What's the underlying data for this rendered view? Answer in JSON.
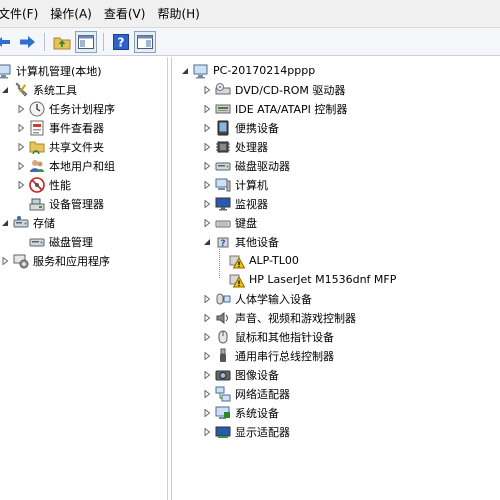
{
  "menubar": {
    "items": [
      "文件(F)",
      "操作(A)",
      "查看(V)",
      "帮助(H)"
    ]
  },
  "left_tree": {
    "root": "计算机管理(本地)",
    "system_tools": "系统工具",
    "task_scheduler": "任务计划程序",
    "event_viewer": "事件查看器",
    "shared_folders": "共享文件夹",
    "local_users": "本地用户和组",
    "performance": "性能",
    "device_manager": "设备管理器",
    "storage": "存储",
    "disk_management": "磁盘管理",
    "services": "服务和应用程序"
  },
  "device_tree": {
    "computer": "PC-20170214pppp",
    "items": [
      "DVD/CD-ROM 驱动器",
      "IDE ATA/ATAPI 控制器",
      "便携设备",
      "处理器",
      "磁盘驱动器",
      "计算机",
      "监视器",
      "键盘",
      "其他设备",
      "ALP-TL00",
      "HP LaserJet M1536dnf MFP",
      "人体学输入设备",
      "声音、视频和游戏控制器",
      "鼠标和其他指针设备",
      "通用串行总线控制器",
      "图像设备",
      "网络适配器",
      "系统设备",
      "显示适配器"
    ]
  },
  "colors": {
    "menubar_bg": "#f0f0f0",
    "toolbar_bg": "#f4f6f9",
    "warning": "#f2c200"
  }
}
